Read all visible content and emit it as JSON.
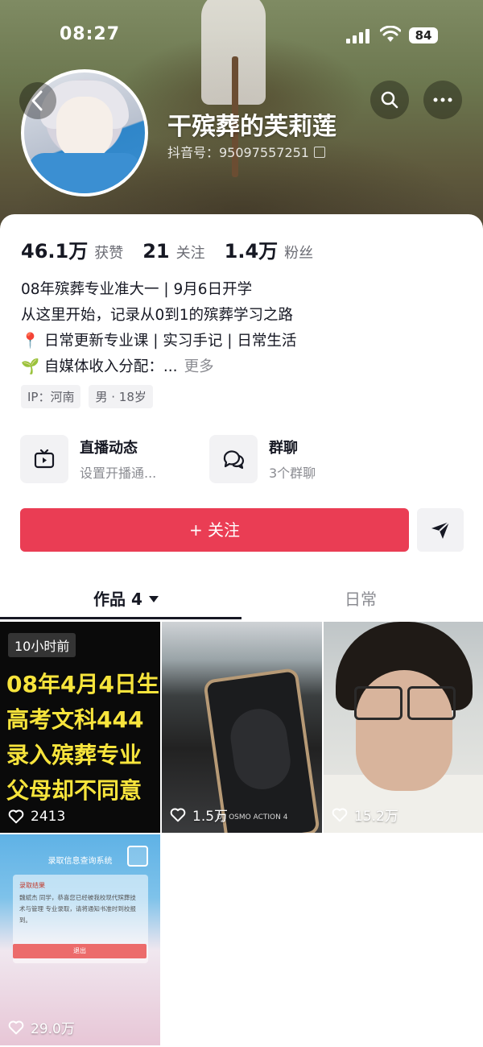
{
  "status_bar": {
    "time": "08:27",
    "battery": "84"
  },
  "profile": {
    "username": "干殡葬的芙莉莲",
    "douyin_id": "抖音号：95097557251"
  },
  "stats": [
    {
      "value": "46.1万",
      "label": "获赞"
    },
    {
      "value": "21",
      "label": "关注"
    },
    {
      "value": "1.4万",
      "label": "粉丝"
    }
  ],
  "bio": {
    "lines": [
      "08年殡葬专业准大一 | 9月6日开学",
      "从这里开始，记录从0到1的殡葬学习之路",
      "📍 日常更新专业课 | 实习手记 | 日常生活",
      "🌱 自媒体收入分配：..."
    ],
    "more": "更多"
  },
  "tags": [
    "IP：河南",
    "男 · 18岁"
  ],
  "shortcuts": [
    {
      "title": "直播动态",
      "subtitle": "设置开播通...",
      "icon": "tv-icon"
    },
    {
      "title": "群聊",
      "subtitle": "3个群聊",
      "icon": "chat-icon"
    }
  ],
  "actions": {
    "follow": "+ 关注",
    "share_icon": "send-icon"
  },
  "tabs": {
    "works": "作品 4",
    "daily": "日常"
  },
  "videos": [
    {
      "badge": "10小时前",
      "overlay_lines": [
        "08年4月4日生",
        "高考文科444",
        "录入殡葬专业",
        "父母却不同意"
      ],
      "likes": "2413"
    },
    {
      "likes": "1.5万",
      "watermark": "DJI OSMO ACTION 4"
    },
    {
      "likes": "15.2万"
    },
    {
      "system_title": "录取信息查询系统",
      "notice_title": "录取结果",
      "notice_body": "魏斌杰 同学，恭喜您已经被我校现代殡葬技术与管理 专业录取，请将通知书准时到校报到。",
      "exit_label": "退出",
      "likes": "29.0万"
    }
  ],
  "colors": {
    "accent": "#ea3d54",
    "title_yellow": "#f7e43c"
  }
}
